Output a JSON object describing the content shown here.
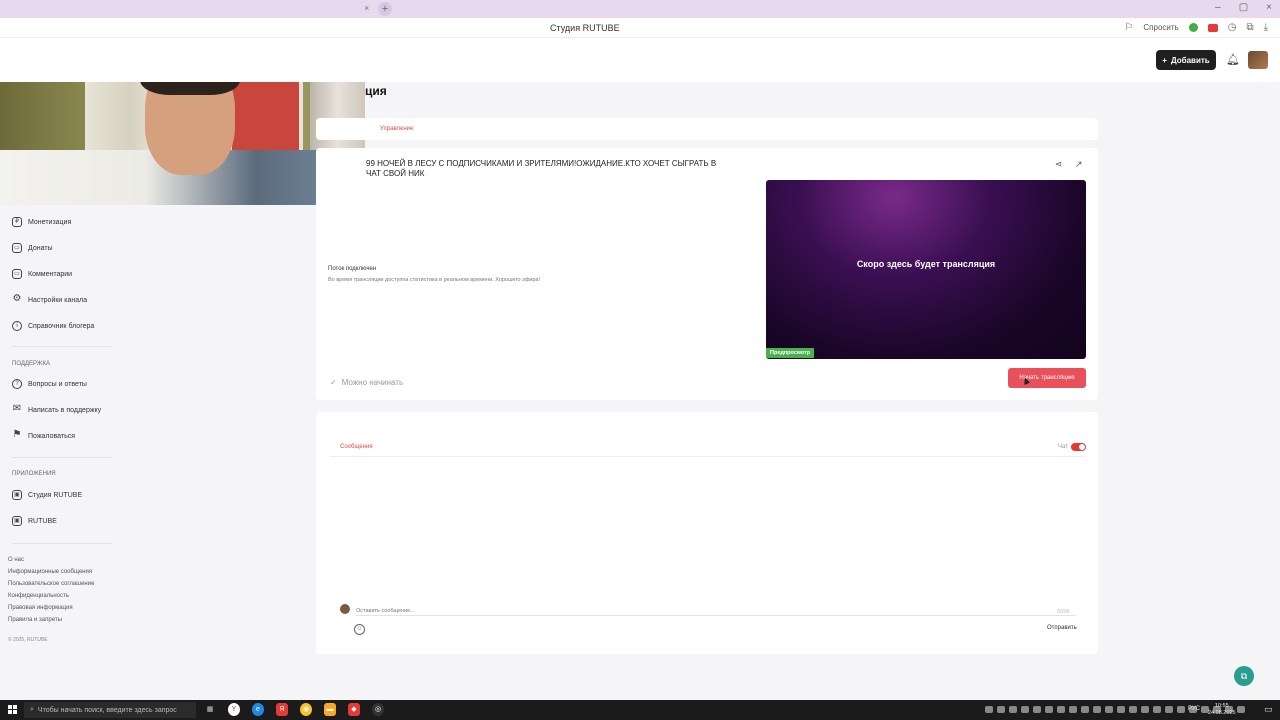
{
  "browser": {
    "tab_close": "×",
    "tab_new": "+",
    "page_title": "Студия RUTUBE",
    "ask_label": "Спросить",
    "window_controls": [
      "–",
      "▢",
      "×"
    ]
  },
  "header": {
    "add_label": "Добавить",
    "page_title": "ция"
  },
  "tabs": {
    "active": "Управление"
  },
  "stream": {
    "title": "99 НОЧЕЙ В ЛЕСУ С ПОДПИСЧИКАМИ И ЗРИТЕЛЯМИ!ОЖИДАНИЕ.КТО ХОЧЕТ СЫГРАТЬ В ЧАТ СВОЙ НИК",
    "status_title": "Поток подключен",
    "status_desc": "Во время трансляции доступна статистика в реальном времени. Хорошего эфира!",
    "preview_text": "Скоро здесь будет трансляция",
    "preview_badge": "Предпросмотр",
    "ready_text": "Можно начинать",
    "start_label": "Начать трансляцию"
  },
  "chat": {
    "tab": "Сообщения",
    "label": "Чат",
    "placeholder": "Оставить сообщение...",
    "counter": "0/200",
    "send_label": "Отправить"
  },
  "sidebar": {
    "items": [
      {
        "label": "Монетизация",
        "icon": "money-icon",
        "glyph": "₽"
      },
      {
        "label": "Донаты",
        "icon": "donate-icon",
        "glyph": "▭"
      },
      {
        "label": "Комментарии",
        "icon": "comment-icon",
        "glyph": "▭"
      },
      {
        "label": "Настройки канала",
        "icon": "gear-icon",
        "glyph": "⚙"
      },
      {
        "label": "Справочник блогера",
        "icon": "info-icon",
        "glyph": "i"
      }
    ],
    "support_title": "Поддержка",
    "support_items": [
      {
        "label": "Вопросы и ответы",
        "icon": "question-icon",
        "glyph": "?"
      },
      {
        "label": "Написать в поддержку",
        "icon": "mail-icon",
        "glyph": "✉"
      },
      {
        "label": "Пожаловаться",
        "icon": "flag-icon",
        "glyph": "⚑"
      }
    ],
    "apps_title": "Приложения",
    "apps_items": [
      {
        "label": "Студия RUTUBE",
        "icon": "studio-icon",
        "glyph": "▣"
      },
      {
        "label": "RUTUBE",
        "icon": "rutube-icon",
        "glyph": "▣"
      }
    ],
    "footer_links": [
      "О нас",
      "Информационные сообщения",
      "Пользовательское соглашение",
      "Конфиденциальность",
      "Правовая информация",
      "Правила и запреты"
    ],
    "copyright": "© 2025, RUTUBE"
  },
  "taskbar": {
    "search_placeholder": "Чтобы начать поиск, введите здесь запрос",
    "lang": "РУС",
    "time": "10:55",
    "date": "24.08.2025"
  },
  "colors": {
    "accent": "#e8505b",
    "preview_badge": "#4caf50",
    "dark_button": "#1f1f1f"
  }
}
